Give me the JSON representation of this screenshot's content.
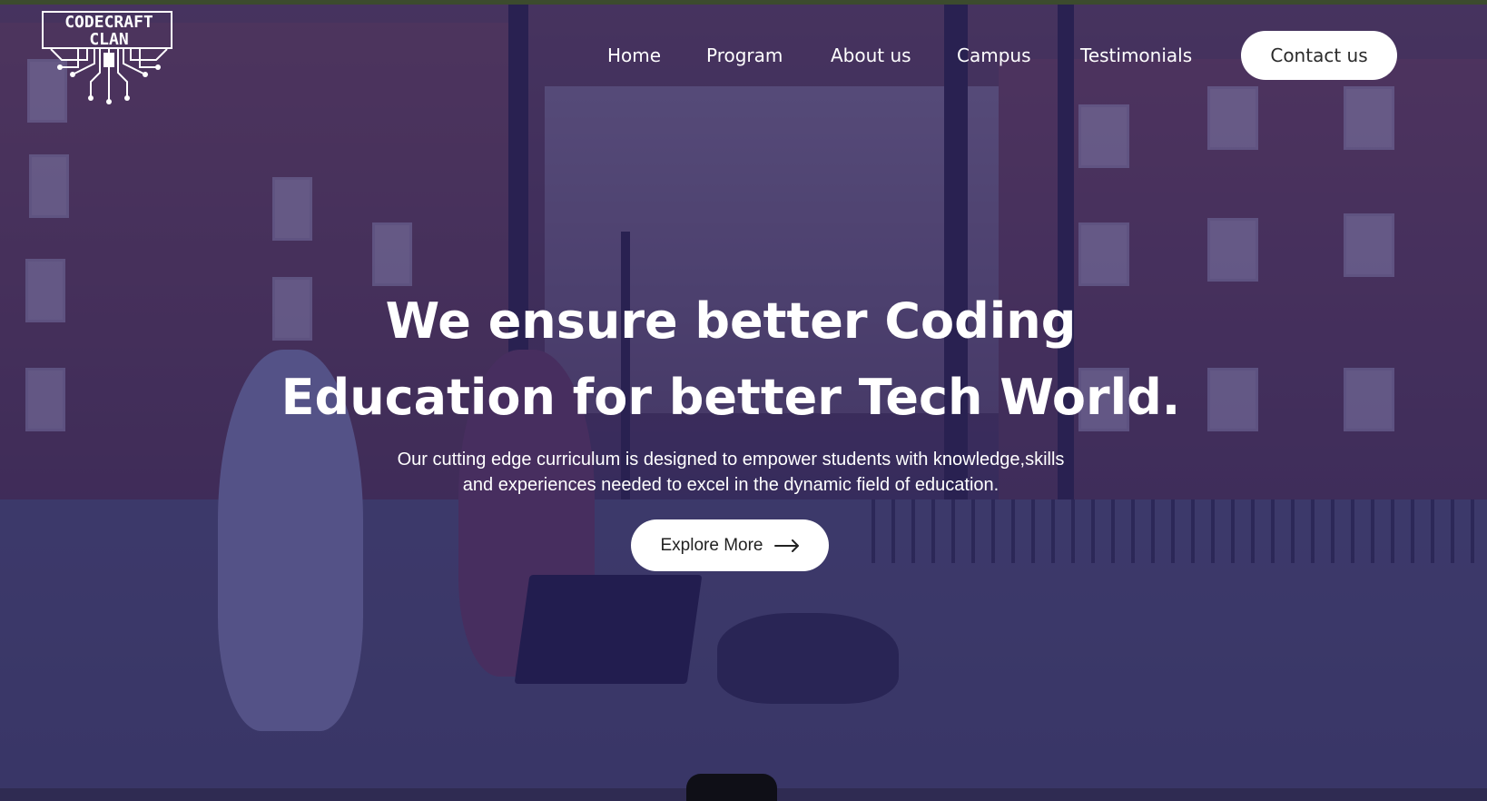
{
  "brand": {
    "logo_line1": "CODECRAFT",
    "logo_line2": "CLAN"
  },
  "nav": {
    "items": [
      {
        "label": "Home"
      },
      {
        "label": "Program"
      },
      {
        "label": "About us"
      },
      {
        "label": "Campus"
      },
      {
        "label": "Testimonials"
      }
    ],
    "contact_label": "Contact us"
  },
  "hero": {
    "title_line1": "We ensure better Coding",
    "title_line2": "Education for better Tech World.",
    "subtitle_line1": "Our cutting edge curriculum is designed to empower students with knowledge,skills",
    "subtitle_line2": "and experiences needed to excel in the dynamic field of education.",
    "cta_label": "Explore More",
    "cta_icon": "arrow-right-icon"
  },
  "colors": {
    "overlay": "#28206e",
    "button_bg": "#ffffff",
    "text": "#ffffff"
  }
}
